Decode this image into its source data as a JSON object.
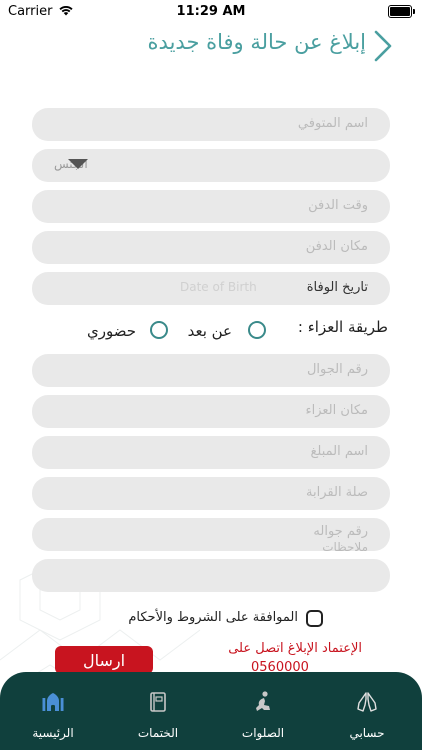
{
  "status_bar": {
    "carrier": "Carrier",
    "time": "11:29 AM"
  },
  "header": {
    "title": "إبلاغ عن حالة وفاة جديدة",
    "back_icon": "chevron-right-icon"
  },
  "form": {
    "deceased_name_placeholder": "اسم المتوفي",
    "gender_select_placeholder": "الجنس",
    "burial_time_placeholder": "وقت الدفن",
    "burial_place_placeholder": "مكان الدفن",
    "death_date_label": "تاريخ الوفاة",
    "death_date_placeholder": "Date of Birth",
    "condolence_label": "طريقة العزاء :",
    "condolence_options": [
      "عن بعد",
      "حضوري"
    ],
    "mobile_placeholder": "رقم الجوال",
    "condolence_place_placeholder": "مكان العزاء",
    "reporter_name_placeholder": "اسم المبلغ",
    "relation_placeholder": "صلة القرابة",
    "reporter_mobile_placeholder": "رقم جواله",
    "notes_placeholder": "ملاحظات",
    "terms_label": "الموافقة على الشروط والأحكام",
    "send_label": "ارسال",
    "contact_text": "الإعتماد الإبلاغ اتصل على",
    "contact_number": "0560000"
  },
  "tabs": [
    {
      "label": "حسابي",
      "icon": "hands-icon"
    },
    {
      "label": "الصلوات",
      "icon": "praying-person-icon"
    },
    {
      "label": "الختمات",
      "icon": "quran-book-icon"
    },
    {
      "label": "الرئيسية",
      "icon": "mosque-home-icon",
      "active": true
    }
  ],
  "colors": {
    "accent": "#4a9fa0",
    "tabbar": "#10403d",
    "send_button": "#c8141f",
    "field_bg": "#e9e9e9"
  }
}
